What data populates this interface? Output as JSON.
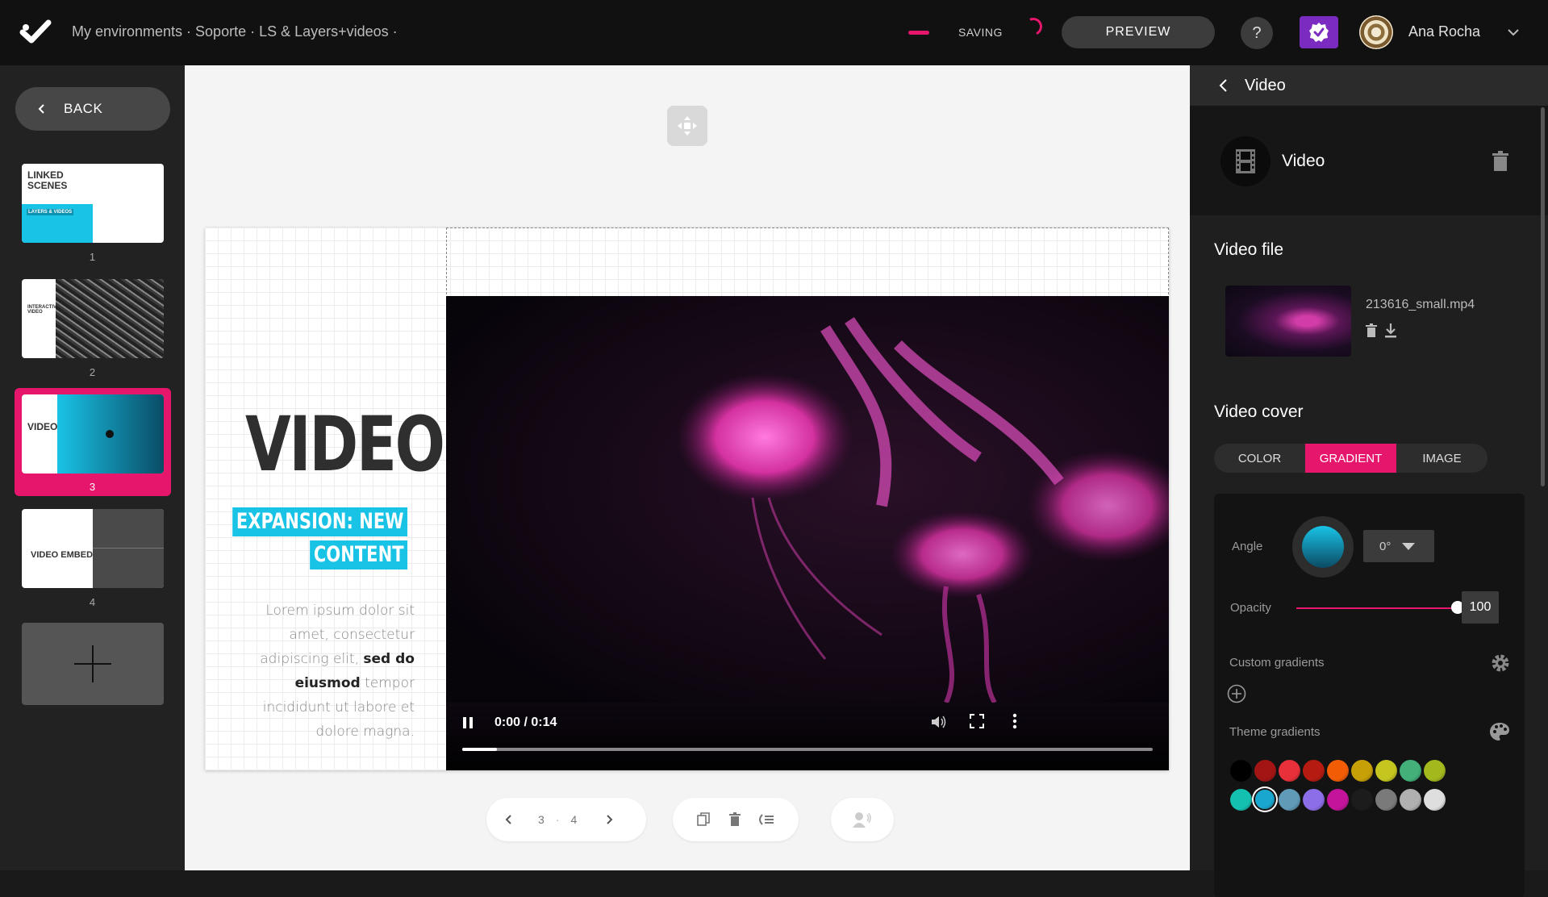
{
  "topbar": {
    "breadcrumb": "My environments · Soporte · LS & Layers+videos ·",
    "saving": "SAVING",
    "preview": "PREVIEW",
    "help": "?",
    "user_name": "Ana Rocha"
  },
  "sidebar": {
    "back": "BACK",
    "slides": [
      {
        "number": "1",
        "title": "LINKED SCENES",
        "sub": "LAYERS & VIDEOS"
      },
      {
        "number": "2",
        "title": "INTERACTIVE VIDEO",
        "sub": ""
      },
      {
        "number": "3",
        "title": "VIDEO",
        "sub": ""
      },
      {
        "number": "4",
        "title": "VIDEO EMBED",
        "sub": ""
      }
    ],
    "active_slide": 3
  },
  "slide": {
    "title": "VIDEO",
    "sub_line1": "EXPANSION: NEW",
    "sub_line2": "CONTENT",
    "lorem_a": "Lorem ipsum dolor sit amet, consectetur adipiscing elit,",
    "lorem_b": "sed do eiusmod",
    "lorem_c": "tempor incididunt ut labore et dolore magna.",
    "video_time": "0:00 / 0:14",
    "video_progress": 0.05
  },
  "canvas_nav": {
    "current": "3",
    "sep": "·",
    "total": "4"
  },
  "panel": {
    "header": "Video",
    "element_label": "Video",
    "video_file_title": "Video file",
    "file_name": "213616_small.mp4",
    "video_cover_title": "Video cover",
    "tabs": [
      "COLOR",
      "GRADIENT",
      "IMAGE"
    ],
    "active_tab": "GRADIENT",
    "angle_label": "Angle",
    "angle_value": "0°",
    "opacity_label": "Opacity",
    "opacity_value": "100",
    "custom_gradients": "Custom gradients",
    "theme_gradients": "Theme gradients",
    "swatches_row1": [
      "#000000",
      "#a31515",
      "#e8303a",
      "#b51b10",
      "#f25c05",
      "#c7a008",
      "#c5c51f",
      "#43b07a",
      "#a2b81c"
    ],
    "swatches_row2": [
      "#14c1b1",
      "#19a6cf",
      "#5f9ab7",
      "#8c6ee8",
      "#c3149b",
      "#1c1c1c",
      "#7a7a7a",
      "#b0b0b0",
      "#dedede"
    ],
    "selected_swatch": 1
  },
  "colors": {
    "accent": "#e6166c",
    "cyan": "#19c3e6",
    "purple": "#7b2bbf"
  }
}
